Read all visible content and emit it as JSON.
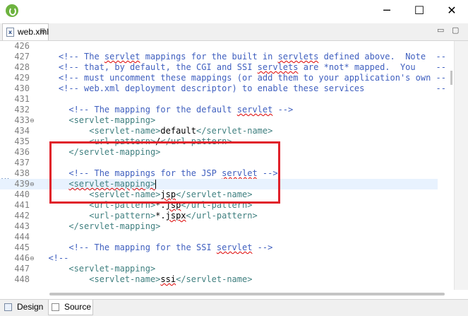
{
  "window": {
    "minimize_glyph": "─",
    "maximize_glyph": "☐",
    "close_glyph": "✕"
  },
  "tab": {
    "icon_text": "x",
    "label": "web.xml",
    "close_glyph": "⊠"
  },
  "view_controls": {
    "minimize_glyph": "▭",
    "maximize_glyph": "▢"
  },
  "editor": {
    "lines": [
      {
        "n": "426",
        "fold": false,
        "current": false,
        "segs": []
      },
      {
        "n": "427",
        "fold": false,
        "current": false,
        "segs": [
          {
            "t": "    <!-- The ",
            "cls": "c"
          },
          {
            "t": "servlet",
            "cls": "c sq"
          },
          {
            "t": " mappings for the built in ",
            "cls": "c"
          },
          {
            "t": "servlets",
            "cls": "c sq"
          },
          {
            "t": " defined above.  Note  -->",
            "cls": "c"
          }
        ]
      },
      {
        "n": "428",
        "fold": false,
        "current": false,
        "segs": [
          {
            "t": "    <!-- that, by default, the CGI and SSI ",
            "cls": "c"
          },
          {
            "t": "servlets",
            "cls": "c sq"
          },
          {
            "t": " are *not* mapped.  You    -->",
            "cls": "c"
          }
        ]
      },
      {
        "n": "429",
        "fold": false,
        "current": false,
        "segs": [
          {
            "t": "    <!-- must uncomment these mappings (or add them to your application's own -->",
            "cls": "c"
          }
        ]
      },
      {
        "n": "430",
        "fold": false,
        "current": false,
        "segs": [
          {
            "t": "    <!-- web.xml deployment descriptor) to enable these services              -->",
            "cls": "c"
          }
        ]
      },
      {
        "n": "431",
        "fold": false,
        "current": false,
        "segs": []
      },
      {
        "n": "432",
        "fold": false,
        "current": false,
        "segs": [
          {
            "t": "      <!-- The mapping for the default ",
            "cls": "c"
          },
          {
            "t": "servlet",
            "cls": "c sq"
          },
          {
            "t": " -->",
            "cls": "c"
          }
        ]
      },
      {
        "n": "433",
        "fold": true,
        "current": false,
        "segs": [
          {
            "t": "      <servlet-mapping>",
            "cls": "t"
          }
        ]
      },
      {
        "n": "434",
        "fold": false,
        "current": false,
        "segs": [
          {
            "t": "          <servlet-name>",
            "cls": "t"
          },
          {
            "t": "default",
            "cls": "x"
          },
          {
            "t": "</servlet-name>",
            "cls": "t"
          }
        ]
      },
      {
        "n": "435",
        "fold": false,
        "current": false,
        "segs": [
          {
            "t": "          <url-pattern>",
            "cls": "t"
          },
          {
            "t": "/",
            "cls": "x"
          },
          {
            "t": "</url-pattern>",
            "cls": "t"
          }
        ]
      },
      {
        "n": "436",
        "fold": false,
        "current": false,
        "segs": [
          {
            "t": "      </servlet-mapping>",
            "cls": "t"
          }
        ]
      },
      {
        "n": "437",
        "fold": false,
        "current": false,
        "segs": []
      },
      {
        "n": "438",
        "fold": false,
        "current": false,
        "segs": [
          {
            "t": "      <!-- The mappings for the JSP ",
            "cls": "c"
          },
          {
            "t": "servlet",
            "cls": "c sq"
          },
          {
            "t": " -->",
            "cls": "c"
          }
        ]
      },
      {
        "n": "439",
        "fold": true,
        "current": true,
        "segs": [
          {
            "t": "      ",
            "cls": "t"
          },
          {
            "t": "<servlet-mapping>",
            "cls": "t sq"
          }
        ],
        "cursor": true
      },
      {
        "n": "440",
        "fold": false,
        "current": false,
        "segs": [
          {
            "t": "          <servlet-name>",
            "cls": "t"
          },
          {
            "t": "jsp",
            "cls": "x sq"
          },
          {
            "t": "</servlet-name>",
            "cls": "t"
          }
        ]
      },
      {
        "n": "441",
        "fold": false,
        "current": false,
        "segs": [
          {
            "t": "          <url-pattern>",
            "cls": "t"
          },
          {
            "t": "*.",
            "cls": "x"
          },
          {
            "t": "jsp",
            "cls": "x sq"
          },
          {
            "t": "</url-pattern>",
            "cls": "t"
          }
        ]
      },
      {
        "n": "442",
        "fold": false,
        "current": false,
        "segs": [
          {
            "t": "          <url-pattern>",
            "cls": "t"
          },
          {
            "t": "*.",
            "cls": "x"
          },
          {
            "t": "jspx",
            "cls": "x sq"
          },
          {
            "t": "</url-pattern>",
            "cls": "t"
          }
        ]
      },
      {
        "n": "443",
        "fold": false,
        "current": false,
        "segs": [
          {
            "t": "      </servlet-mapping>",
            "cls": "t"
          }
        ]
      },
      {
        "n": "444",
        "fold": false,
        "current": false,
        "segs": []
      },
      {
        "n": "445",
        "fold": false,
        "current": false,
        "segs": [
          {
            "t": "      <!-- The mapping for the SSI ",
            "cls": "c"
          },
          {
            "t": "servlet",
            "cls": "c sq"
          },
          {
            "t": " -->",
            "cls": "c"
          }
        ]
      },
      {
        "n": "446",
        "fold": true,
        "current": false,
        "segs": [
          {
            "t": "  <!--",
            "cls": "c"
          }
        ]
      },
      {
        "n": "447",
        "fold": false,
        "current": false,
        "segs": [
          {
            "t": "      <servlet-mapping>",
            "cls": "t"
          }
        ]
      },
      {
        "n": "448",
        "fold": false,
        "current": false,
        "segs": [
          {
            "t": "          <servlet-name>",
            "cls": "t"
          },
          {
            "t": "ssi",
            "cls": "x sq"
          },
          {
            "t": "</servlet-name>",
            "cls": "t"
          }
        ]
      }
    ]
  },
  "bottom_tabs": {
    "design_label": "Design",
    "source_label": "Source",
    "active": "Source"
  },
  "colors": {
    "comment": "#3f5fbf",
    "tag": "#3f7f7f",
    "highlight_box": "#e0202a",
    "current_line": "#e8f2fe"
  }
}
